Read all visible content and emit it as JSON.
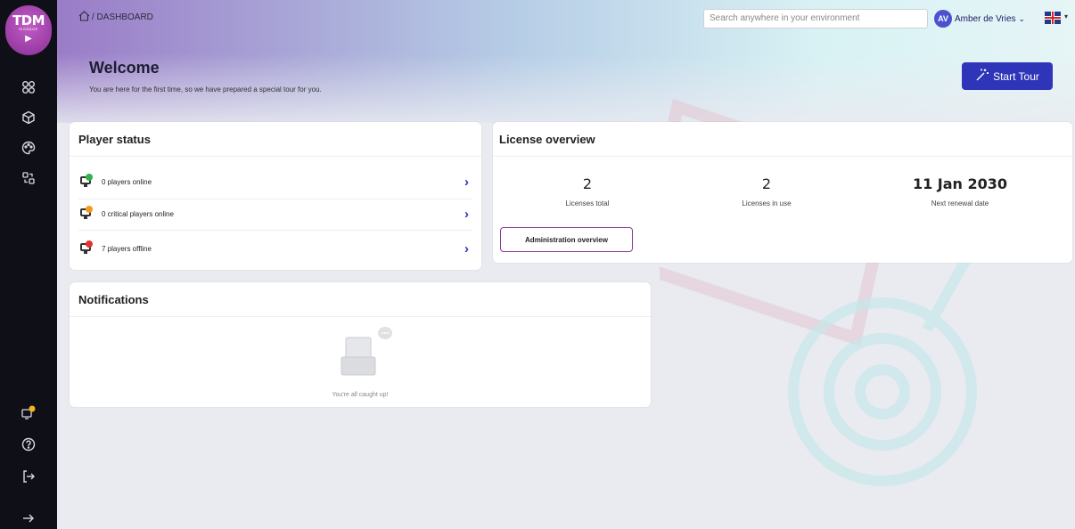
{
  "app": {
    "logo_text": "TDM",
    "logo_sub": "SIGNAGE"
  },
  "header": {
    "breadcrumb": "/ DASHBOARD",
    "search_placeholder": "Search anywhere in your environment",
    "user": {
      "initials": "AV",
      "name": "Amber de Vries"
    }
  },
  "welcome": {
    "title": "Welcome",
    "text": "You are here for the first time, so we have prepared a special tour for you.",
    "tour_button": "Start Tour"
  },
  "player_status": {
    "title": "Player status",
    "rows": [
      {
        "label": "0 players online",
        "status_color": "#2fb34a"
      },
      {
        "label": "0 critical players online",
        "status_color": "#f39a1e"
      },
      {
        "label": "7 players offline",
        "status_color": "#e0332e"
      }
    ]
  },
  "license": {
    "title": "License overview",
    "stats": [
      {
        "value": "2",
        "label": "Licenses total"
      },
      {
        "value": "2",
        "label": "Licenses in use"
      },
      {
        "value": "11 Jan 2030",
        "label": "Next renewal date"
      }
    ],
    "admin_button": "Administration overview"
  },
  "notifications": {
    "title": "Notifications",
    "empty_text": "You're all caught up!"
  },
  "sidebar": {
    "icons": [
      "dashboard-icon",
      "cube-icon",
      "palette-icon",
      "users-icon",
      "notification-bell-icon",
      "help-icon",
      "logout-icon",
      "expand-icon"
    ]
  },
  "colors": {
    "accent": "#2f35b8",
    "brand": "#8e3a98",
    "sidebar": "#0f0f17"
  }
}
